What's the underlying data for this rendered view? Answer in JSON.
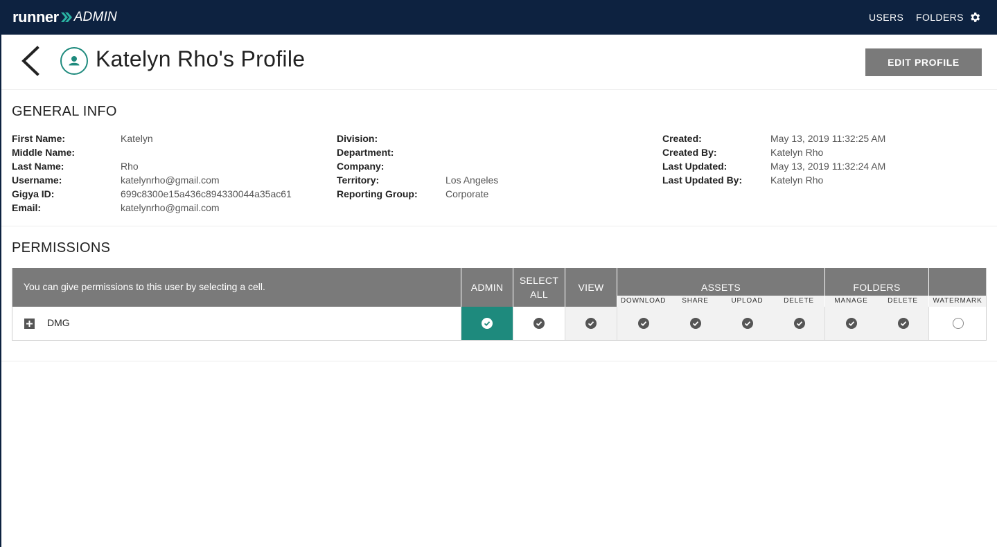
{
  "app": {
    "brand_runner": "runner",
    "brand_admin": "ADMIN",
    "nav_users": "USERS",
    "nav_folders": "FOLDERS",
    "nav_bg": "#0d2240",
    "accent": "#1e8a7d"
  },
  "header": {
    "title": "Katelyn Rho's Profile",
    "edit_label": "EDIT PROFILE"
  },
  "general": {
    "title": "GENERAL INFO",
    "col1": [
      {
        "label": "First Name:",
        "value": "Katelyn"
      },
      {
        "label": "Middle Name:",
        "value": ""
      },
      {
        "label": "Last Name:",
        "value": "Rho"
      },
      {
        "label": "Username:",
        "value": "katelynrho@gmail.com"
      },
      {
        "label": "Gigya ID:",
        "value": "699c8300e15a436c894330044a35ac61"
      },
      {
        "label": "Email:",
        "value": "katelynrho@gmail.com"
      }
    ],
    "col2": [
      {
        "label": "Division:",
        "value": ""
      },
      {
        "label": "Department:",
        "value": ""
      },
      {
        "label": "Company:",
        "value": ""
      },
      {
        "label": "Territory:",
        "value": "Los Angeles"
      },
      {
        "label": "Reporting Group:",
        "value": "Corporate"
      }
    ],
    "col3": [
      {
        "label": "Created:",
        "value": "May 13, 2019 11:32:25 AM"
      },
      {
        "label": "Created By:",
        "value": "Katelyn Rho"
      },
      {
        "label": "Last Updated:",
        "value": "May 13, 2019 11:32:24 AM"
      },
      {
        "label": "Last Updated By:",
        "value": "Katelyn Rho"
      }
    ]
  },
  "permissions": {
    "title": "PERMISSIONS",
    "note": "You can give permissions to this user by selecting a cell.",
    "headers": {
      "admin": "ADMIN",
      "select_all_1": "SELECT",
      "select_all_2": "ALL",
      "view": "VIEW",
      "assets": "ASSETS",
      "folders": "FOLDERS",
      "watermark": "WATERMARK"
    },
    "sub_headers": {
      "download": "DOWNLOAD",
      "share": "SHARE",
      "upload": "UPLOAD",
      "asset_delete": "DELETE",
      "manage": "MANAGE",
      "folder_delete": "DELETE"
    },
    "rows": [
      {
        "name": "DMG",
        "admin": true,
        "select_all": true,
        "view": true,
        "download": true,
        "share": true,
        "upload": true,
        "asset_delete": true,
        "manage": true,
        "folder_delete": true,
        "watermark": false
      }
    ]
  }
}
